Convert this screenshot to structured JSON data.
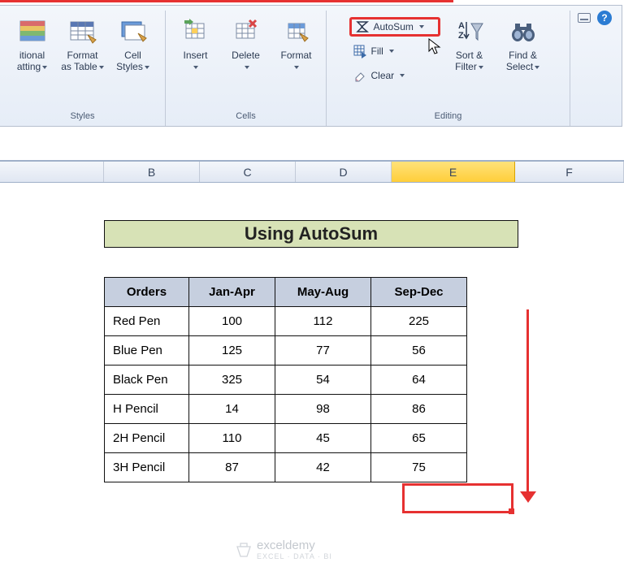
{
  "column_headers": {
    "b": "B",
    "c": "C",
    "d": "D",
    "e": "E",
    "f": "F"
  },
  "ribbon": {
    "styles_group": "Styles",
    "cells_group": "Cells",
    "editing_group": "Editing",
    "cond_fmt": "itional\natting",
    "fmt_table": "Format\nas Table",
    "cell_styles": "Cell\nStyles",
    "insert": "Insert",
    "delete": "Delete",
    "format": "Format",
    "autosum": "AutoSum",
    "fill": "Fill",
    "clear": "Clear",
    "sort_filter": "Sort &\nFilter",
    "find_select": "Find &\nSelect"
  },
  "title_cell": "Using AutoSum",
  "table": {
    "headers": {
      "orders": "Orders",
      "jan": "Jan-Apr",
      "may": "May-Aug",
      "sep": "Sep-Dec"
    },
    "rows": [
      {
        "name": "Red Pen",
        "jan": "100",
        "may": "112",
        "sep": "225"
      },
      {
        "name": "Blue Pen",
        "jan": "125",
        "may": "77",
        "sep": "56"
      },
      {
        "name": "Black Pen",
        "jan": "325",
        "may": "54",
        "sep": "64"
      },
      {
        "name": "H Pencil",
        "jan": "14",
        "may": "98",
        "sep": "86"
      },
      {
        "name": "2H Pencil",
        "jan": "110",
        "may": "45",
        "sep": "65"
      },
      {
        "name": "3H Pencil",
        "jan": "87",
        "may": "42",
        "sep": "75"
      }
    ]
  },
  "chart_data": {
    "type": "table",
    "title": "Using AutoSum",
    "columns": [
      "Orders",
      "Jan-Apr",
      "May-Aug",
      "Sep-Dec"
    ],
    "rows": [
      [
        "Red Pen",
        100,
        112,
        225
      ],
      [
        "Blue Pen",
        125,
        77,
        56
      ],
      [
        "Black Pen",
        325,
        54,
        64
      ],
      [
        "H Pencil",
        14,
        98,
        86
      ],
      [
        "2H Pencil",
        110,
        45,
        65
      ],
      [
        "3H Pencil",
        87,
        42,
        75
      ]
    ]
  },
  "watermark": {
    "brand": "exceldemy",
    "sub": "EXCEL · DATA · BI"
  }
}
